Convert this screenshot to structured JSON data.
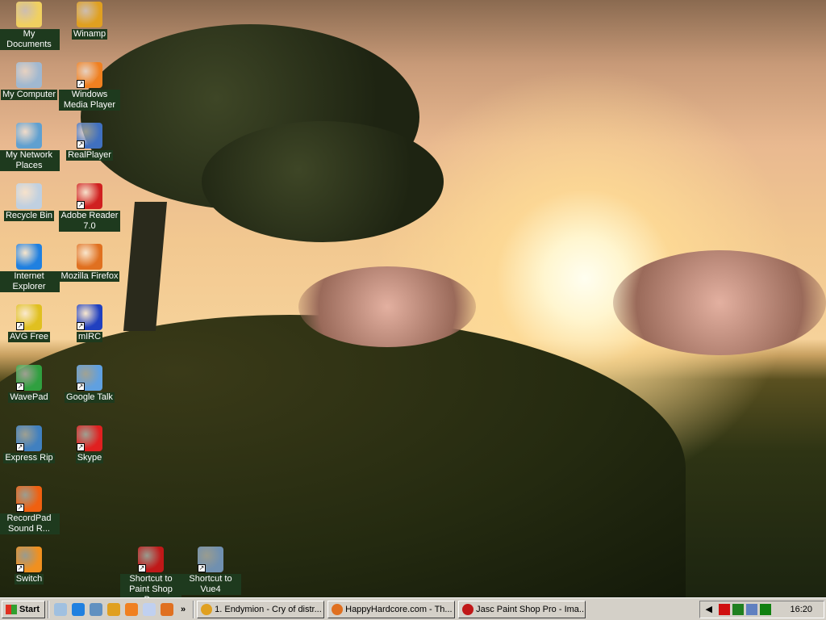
{
  "desktop_icons": [
    {
      "label": "My Documents",
      "icon": "folder-icon",
      "color": "#f0d060"
    },
    {
      "label": "Winamp",
      "icon": "winamp-icon",
      "color": "#e0a020"
    },
    {
      "label": "My Computer",
      "icon": "computer-icon",
      "color": "#a0b8d0"
    },
    {
      "label": "Windows Media Player",
      "icon": "media-player-icon",
      "color": "#f08020"
    },
    {
      "label": "My Network Places",
      "icon": "network-icon",
      "color": "#60a0d0"
    },
    {
      "label": "RealPlayer",
      "icon": "realplayer-icon",
      "color": "#4070c0"
    },
    {
      "label": "Recycle Bin",
      "icon": "recycle-bin-icon",
      "color": "#c0d0e0"
    },
    {
      "label": "Adobe Reader 7.0",
      "icon": "adobe-reader-icon",
      "color": "#d02020"
    },
    {
      "label": "Internet Explorer",
      "icon": "internet-explorer-icon",
      "color": "#2080e0"
    },
    {
      "label": "Mozilla Firefox",
      "icon": "firefox-icon",
      "color": "#e07020"
    },
    {
      "label": "AVG Free",
      "icon": "avg-icon",
      "color": "#e0c020"
    },
    {
      "label": "mIRC",
      "icon": "mirc-icon",
      "color": "#2040c0"
    },
    {
      "label": "WavePad",
      "icon": "wavepad-icon",
      "color": "#30a040"
    },
    {
      "label": "Google Talk",
      "icon": "google-talk-icon",
      "color": "#60a0e0"
    },
    {
      "label": "Express Rip",
      "icon": "express-rip-icon",
      "color": "#4080c0"
    },
    {
      "label": "Skype",
      "icon": "skype-icon",
      "color": "#e02020"
    },
    {
      "label": "RecordPad Sound R...",
      "icon": "recordpad-icon",
      "color": "#f06010"
    },
    {
      "label": "Switch",
      "icon": "switch-icon",
      "color": "#f09020"
    },
    {
      "label": "Shortcut to Paint Shop Pro",
      "icon": "paint-shop-pro-icon",
      "color": "#c01818"
    },
    {
      "label": "Shortcut to Vue4",
      "icon": "vue4-icon",
      "color": "#7090b0"
    }
  ],
  "taskbar": {
    "start_label": "Start",
    "quick_launch": [
      "show-desktop",
      "internet-explorer",
      "outlook-express",
      "winamp",
      "media-player",
      "notes",
      "firefox"
    ],
    "overflow_label": "»",
    "tasks": [
      {
        "label": "1. Endymion - Cry of distr...",
        "icon": "winamp-icon",
        "color": "#e0a020"
      },
      {
        "label": "HappyHardcore.com - Th...",
        "icon": "firefox-icon",
        "color": "#e07020"
      },
      {
        "label": "Jasc Paint Shop Pro - Ima...",
        "icon": "paint-shop-pro-icon",
        "color": "#c01818"
      }
    ],
    "tray_icons": [
      "volume-icon",
      "ati-icon",
      "display-icon",
      "network-icon",
      "meter-icon"
    ],
    "clock": "16:20"
  }
}
